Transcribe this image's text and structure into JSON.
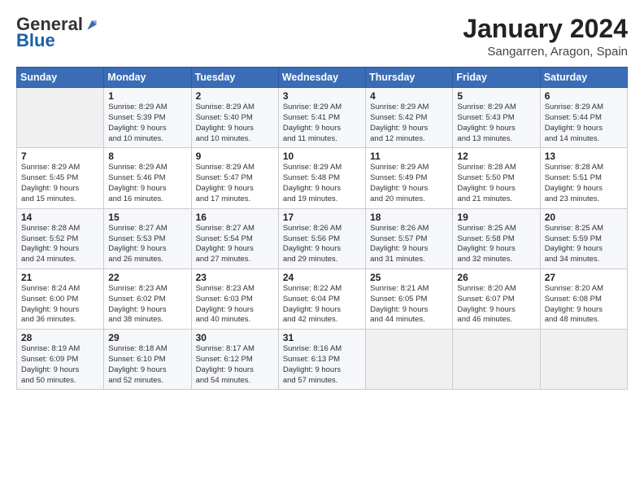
{
  "logo": {
    "general": "General",
    "blue": "Blue"
  },
  "title": "January 2024",
  "location": "Sangarren, Aragon, Spain",
  "days_header": [
    "Sunday",
    "Monday",
    "Tuesday",
    "Wednesday",
    "Thursday",
    "Friday",
    "Saturday"
  ],
  "weeks": [
    [
      {
        "day": "",
        "info": ""
      },
      {
        "day": "1",
        "info": "Sunrise: 8:29 AM\nSunset: 5:39 PM\nDaylight: 9 hours\nand 10 minutes."
      },
      {
        "day": "2",
        "info": "Sunrise: 8:29 AM\nSunset: 5:40 PM\nDaylight: 9 hours\nand 10 minutes."
      },
      {
        "day": "3",
        "info": "Sunrise: 8:29 AM\nSunset: 5:41 PM\nDaylight: 9 hours\nand 11 minutes."
      },
      {
        "day": "4",
        "info": "Sunrise: 8:29 AM\nSunset: 5:42 PM\nDaylight: 9 hours\nand 12 minutes."
      },
      {
        "day": "5",
        "info": "Sunrise: 8:29 AM\nSunset: 5:43 PM\nDaylight: 9 hours\nand 13 minutes."
      },
      {
        "day": "6",
        "info": "Sunrise: 8:29 AM\nSunset: 5:44 PM\nDaylight: 9 hours\nand 14 minutes."
      }
    ],
    [
      {
        "day": "7",
        "info": "Sunrise: 8:29 AM\nSunset: 5:45 PM\nDaylight: 9 hours\nand 15 minutes."
      },
      {
        "day": "8",
        "info": "Sunrise: 8:29 AM\nSunset: 5:46 PM\nDaylight: 9 hours\nand 16 minutes."
      },
      {
        "day": "9",
        "info": "Sunrise: 8:29 AM\nSunset: 5:47 PM\nDaylight: 9 hours\nand 17 minutes."
      },
      {
        "day": "10",
        "info": "Sunrise: 8:29 AM\nSunset: 5:48 PM\nDaylight: 9 hours\nand 19 minutes."
      },
      {
        "day": "11",
        "info": "Sunrise: 8:29 AM\nSunset: 5:49 PM\nDaylight: 9 hours\nand 20 minutes."
      },
      {
        "day": "12",
        "info": "Sunrise: 8:28 AM\nSunset: 5:50 PM\nDaylight: 9 hours\nand 21 minutes."
      },
      {
        "day": "13",
        "info": "Sunrise: 8:28 AM\nSunset: 5:51 PM\nDaylight: 9 hours\nand 23 minutes."
      }
    ],
    [
      {
        "day": "14",
        "info": "Sunrise: 8:28 AM\nSunset: 5:52 PM\nDaylight: 9 hours\nand 24 minutes."
      },
      {
        "day": "15",
        "info": "Sunrise: 8:27 AM\nSunset: 5:53 PM\nDaylight: 9 hours\nand 26 minutes."
      },
      {
        "day": "16",
        "info": "Sunrise: 8:27 AM\nSunset: 5:54 PM\nDaylight: 9 hours\nand 27 minutes."
      },
      {
        "day": "17",
        "info": "Sunrise: 8:26 AM\nSunset: 5:56 PM\nDaylight: 9 hours\nand 29 minutes."
      },
      {
        "day": "18",
        "info": "Sunrise: 8:26 AM\nSunset: 5:57 PM\nDaylight: 9 hours\nand 31 minutes."
      },
      {
        "day": "19",
        "info": "Sunrise: 8:25 AM\nSunset: 5:58 PM\nDaylight: 9 hours\nand 32 minutes."
      },
      {
        "day": "20",
        "info": "Sunrise: 8:25 AM\nSunset: 5:59 PM\nDaylight: 9 hours\nand 34 minutes."
      }
    ],
    [
      {
        "day": "21",
        "info": "Sunrise: 8:24 AM\nSunset: 6:00 PM\nDaylight: 9 hours\nand 36 minutes."
      },
      {
        "day": "22",
        "info": "Sunrise: 8:23 AM\nSunset: 6:02 PM\nDaylight: 9 hours\nand 38 minutes."
      },
      {
        "day": "23",
        "info": "Sunrise: 8:23 AM\nSunset: 6:03 PM\nDaylight: 9 hours\nand 40 minutes."
      },
      {
        "day": "24",
        "info": "Sunrise: 8:22 AM\nSunset: 6:04 PM\nDaylight: 9 hours\nand 42 minutes."
      },
      {
        "day": "25",
        "info": "Sunrise: 8:21 AM\nSunset: 6:05 PM\nDaylight: 9 hours\nand 44 minutes."
      },
      {
        "day": "26",
        "info": "Sunrise: 8:20 AM\nSunset: 6:07 PM\nDaylight: 9 hours\nand 46 minutes."
      },
      {
        "day": "27",
        "info": "Sunrise: 8:20 AM\nSunset: 6:08 PM\nDaylight: 9 hours\nand 48 minutes."
      }
    ],
    [
      {
        "day": "28",
        "info": "Sunrise: 8:19 AM\nSunset: 6:09 PM\nDaylight: 9 hours\nand 50 minutes."
      },
      {
        "day": "29",
        "info": "Sunrise: 8:18 AM\nSunset: 6:10 PM\nDaylight: 9 hours\nand 52 minutes."
      },
      {
        "day": "30",
        "info": "Sunrise: 8:17 AM\nSunset: 6:12 PM\nDaylight: 9 hours\nand 54 minutes."
      },
      {
        "day": "31",
        "info": "Sunrise: 8:16 AM\nSunset: 6:13 PM\nDaylight: 9 hours\nand 57 minutes."
      },
      {
        "day": "",
        "info": ""
      },
      {
        "day": "",
        "info": ""
      },
      {
        "day": "",
        "info": ""
      }
    ]
  ]
}
